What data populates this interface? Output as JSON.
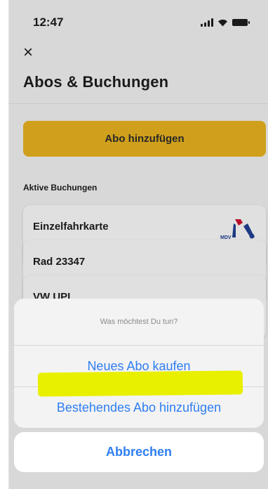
{
  "status_bar": {
    "time": "12:47",
    "icons": [
      "signal-icon",
      "wifi-icon",
      "battery-icon"
    ]
  },
  "header": {
    "close_icon": "×",
    "title": "Abos & Buchungen"
  },
  "actions": {
    "add_subscription_label": "Abo hinzufügen",
    "accent_color": "#e0ad1f"
  },
  "bookings": {
    "section_label": "Aktive Buchungen",
    "items": [
      {
        "title": "Einzelfahrkarte",
        "logo": "MDV"
      },
      {
        "title": "Rad 23347"
      },
      {
        "title": "VW UPL"
      }
    ]
  },
  "action_sheet": {
    "prompt": "Was möchtest Du tun?",
    "options": [
      "Neues Abo kaufen",
      "Bestehendes Abo hinzufügen"
    ],
    "cancel_label": "Abbrechen",
    "link_color": "#2f7ef0",
    "highlight_color": "#e8f000"
  }
}
